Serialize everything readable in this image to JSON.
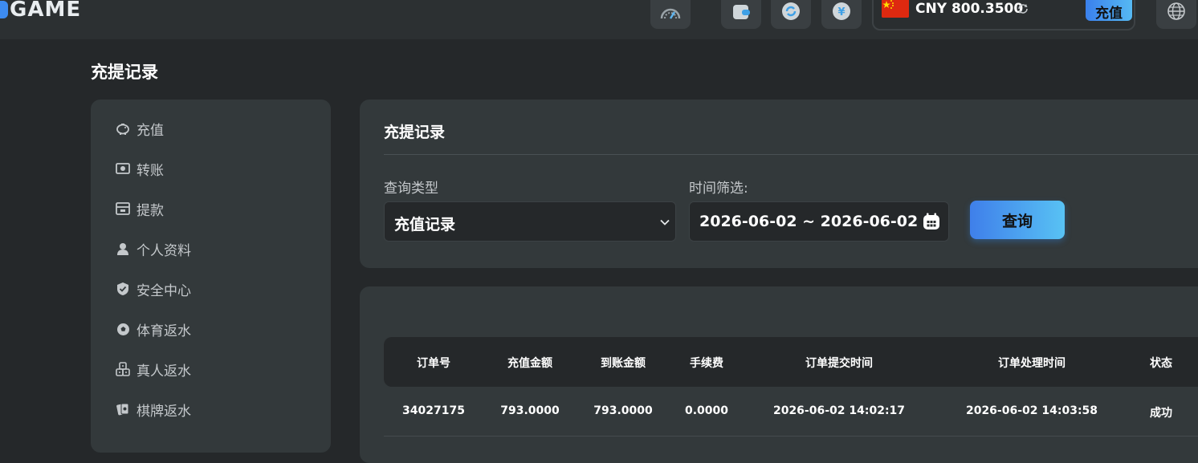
{
  "header": {
    "logo_text": "GAME",
    "currency": "CNY",
    "balance": "800.3500",
    "recharge_label": "充值",
    "icons": [
      "speedometer-icon",
      "wallet-icon",
      "refresh-icon",
      "yuan-coin-icon",
      "globe-icon"
    ],
    "accent": "#3d8bf0"
  },
  "page": {
    "title": "充提记录"
  },
  "sidebar": {
    "items": [
      {
        "label": "充值",
        "icon": "piggy-bank-icon"
      },
      {
        "label": "转账",
        "icon": "money-transfer-icon"
      },
      {
        "label": "提款",
        "icon": "withdraw-icon"
      },
      {
        "label": "个人资料",
        "icon": "user-icon"
      },
      {
        "label": "安全中心",
        "icon": "shield-icon"
      },
      {
        "label": "体育返水",
        "icon": "soccer-ball-icon"
      },
      {
        "label": "真人返水",
        "icon": "dice-icon"
      },
      {
        "label": "棋牌返水",
        "icon": "cards-icon"
      }
    ]
  },
  "filter": {
    "title": "充提记录",
    "type_label": "查询类型",
    "type_value": "充值记录",
    "time_label": "时间筛选:",
    "date_range": "2026-06-02 ~ 2026-06-02",
    "query_label": "查询"
  },
  "table": {
    "columns": [
      "订单号",
      "充值金额",
      "到账金额",
      "手续费",
      "订单提交时间",
      "订单处理时间",
      "状态"
    ],
    "rows": [
      [
        "34027175",
        "793.0000",
        "793.0000",
        "0.0000",
        "2026-06-02 14:02:17",
        "2026-06-02 14:03:58",
        "成功"
      ]
    ]
  }
}
